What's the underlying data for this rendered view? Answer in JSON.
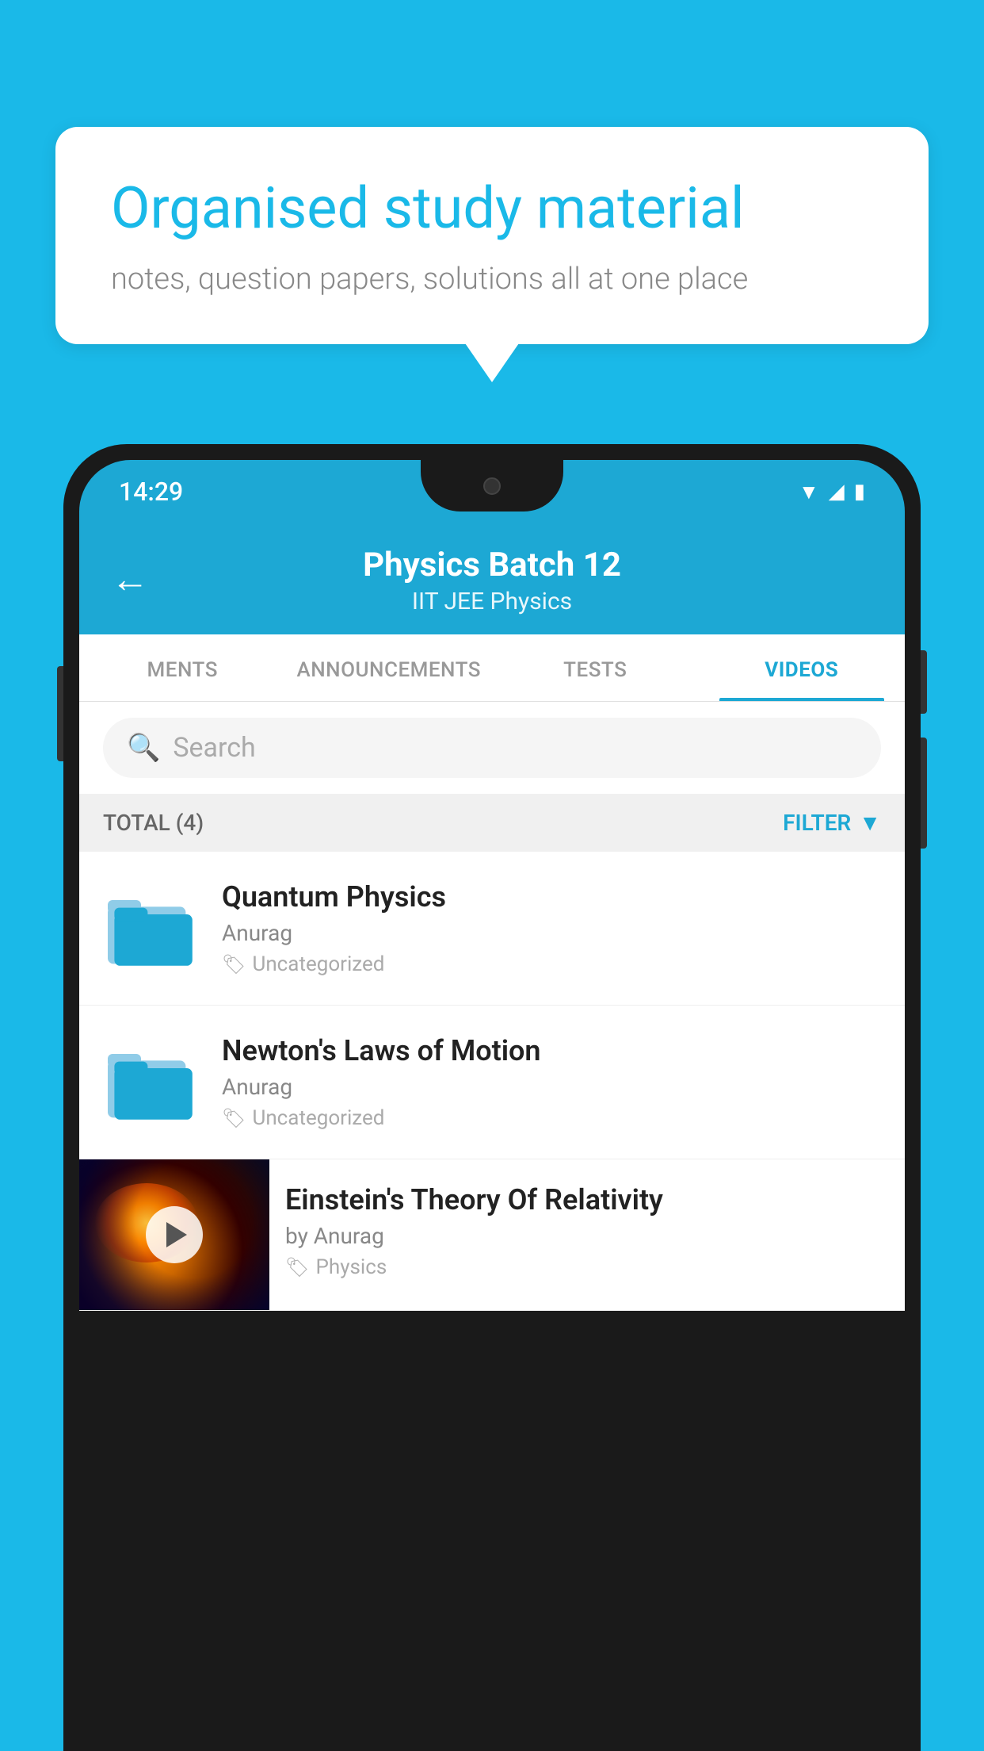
{
  "bubble": {
    "title": "Organised study material",
    "subtitle": "notes, question papers, solutions all at one place"
  },
  "status": {
    "time": "14:29"
  },
  "header": {
    "title": "Physics Batch 12",
    "subtitle": "IIT JEE   Physics",
    "back_label": "←"
  },
  "tabs": [
    {
      "label": "MENTS",
      "active": false
    },
    {
      "label": "ANNOUNCEMENTS",
      "active": false
    },
    {
      "label": "TESTS",
      "active": false
    },
    {
      "label": "VIDEOS",
      "active": true
    }
  ],
  "search": {
    "placeholder": "Search"
  },
  "filter": {
    "total_label": "TOTAL (4)",
    "filter_label": "FILTER"
  },
  "videos": [
    {
      "title": "Quantum Physics",
      "author": "Anurag",
      "tag": "Uncategorized",
      "has_thumb": false
    },
    {
      "title": "Newton's Laws of Motion",
      "author": "Anurag",
      "tag": "Uncategorized",
      "has_thumb": false
    },
    {
      "title": "Einstein's Theory Of Relativity",
      "author": "by Anurag",
      "tag": "Physics",
      "has_thumb": true
    }
  ],
  "colors": {
    "primary": "#1da8d4",
    "background": "#1ab9e8"
  }
}
